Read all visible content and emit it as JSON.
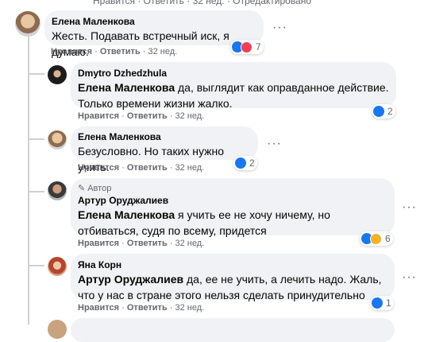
{
  "top_partial": {
    "actions": "Нравится · Ответить · 32 нед. · Отредактировано"
  },
  "comments": [
    {
      "author": "Елена Маленкова",
      "text": "Жесть. Подавать встречный иск, я думаю.",
      "mention": "",
      "like": "Нравится",
      "reply": "Ответить",
      "time": "32 нед.",
      "count": "7"
    },
    {
      "author": "Dmytro Dzhedzhula",
      "mention": "Елена Маленкова",
      "text": " да, выглядит как оправданное действие. Только времени жизни жалко.",
      "like": "Нравится",
      "reply": "Ответить",
      "time": "32 нед.",
      "count": "2"
    },
    {
      "author": "Елена Маленкова",
      "mention": "",
      "text": "Безусловно. Но таких нужно учить.",
      "like": "Нравится",
      "reply": "Ответить",
      "time": "32 нед.",
      "count": "2"
    },
    {
      "badge": "Автор",
      "author": "Артур Оруджалиев",
      "mention": "Елена Маленкова",
      "text": " я учить ее не хочу ничему, но отбиваться, судя по всему, придется",
      "like": "Нравится",
      "reply": "Ответить",
      "time": "32 нед.",
      "count": "6"
    },
    {
      "author": "Яна Корн",
      "mention": "Артур Оруджалиев",
      "text": " да, ее не учить, а лечить надо. Жаль, что у нас в стране этого нельзя сделать принудительно",
      "like": "Нравится",
      "reply": "Ответить",
      "time": "32 нед.",
      "count": "1"
    }
  ],
  "colors": {
    "bubble": "#f0f2f5",
    "like": "#1877f2",
    "love": "#f33e58",
    "haha": "#f7b125",
    "meta": "#65676b"
  },
  "icons": {
    "more": "more-options-icon",
    "like": "like-reaction-icon",
    "love": "love-reaction-icon",
    "haha": "haha-reaction-icon"
  }
}
